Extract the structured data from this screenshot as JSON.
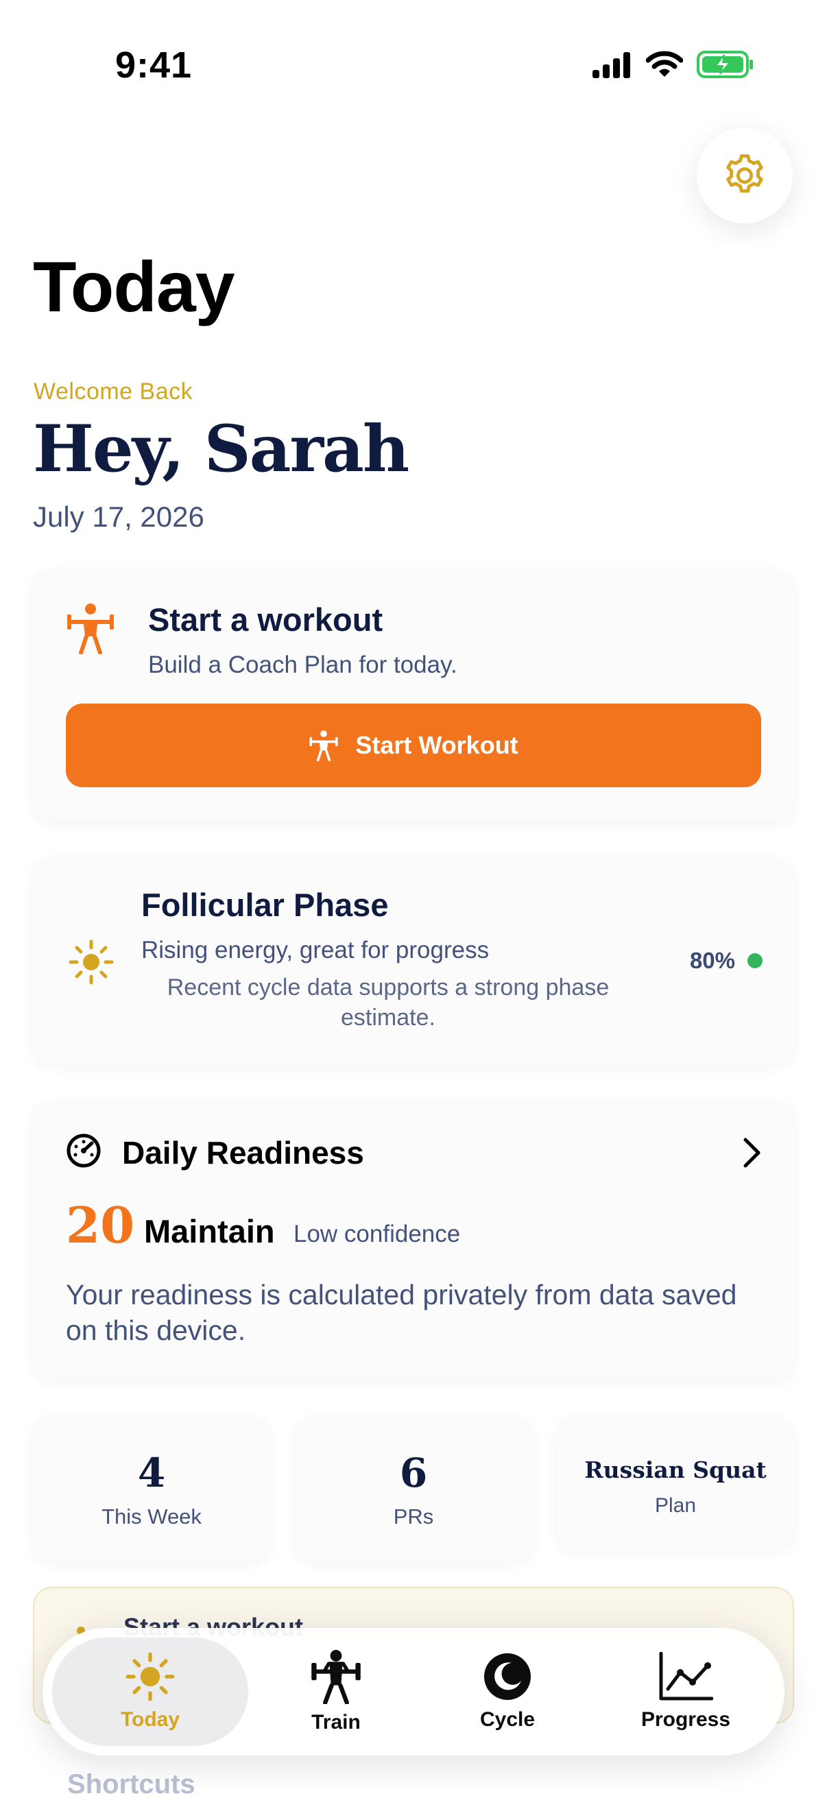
{
  "status_bar": {
    "time": "9:41"
  },
  "header": {
    "title": "Today"
  },
  "welcome": {
    "eyebrow": "Welcome Back",
    "greeting": "Hey, Sarah",
    "date": "July 17, 2026"
  },
  "workout_card": {
    "title": "Start a workout",
    "subtitle": "Build a Coach Plan for today.",
    "button_label": "Start Workout"
  },
  "phase_card": {
    "title": "Follicular Phase",
    "subtitle": "Rising energy, great for progress",
    "note": "Recent cycle data supports a strong phase estimate.",
    "confidence": "80%",
    "confidence_color": "#33b35a"
  },
  "readiness_card": {
    "title": "Daily Readiness",
    "score": "20",
    "label": "Maintain",
    "confidence": "Low confidence",
    "description": "Your readiness is calculated privately from data saved on this device."
  },
  "stats": [
    {
      "value": "4",
      "label": "This Week"
    },
    {
      "value": "6",
      "label": "PRs"
    },
    {
      "value": "Russian Squat",
      "label": "Plan"
    }
  ],
  "peek": {
    "title": "Start a workout",
    "shortcuts_heading": "Shortcuts"
  },
  "tabs": [
    {
      "label": "Today",
      "icon": "sun-icon",
      "active": true
    },
    {
      "label": "Train",
      "icon": "weightlifter-icon"
    },
    {
      "label": "Cycle",
      "icon": "moon-icon"
    },
    {
      "label": "Progress",
      "icon": "chart-line-icon"
    }
  ],
  "colors": {
    "accent_orange": "#f2751e",
    "accent_gold": "#d4a521",
    "navy": "#0f1c3f",
    "battery_green": "#34c759"
  }
}
